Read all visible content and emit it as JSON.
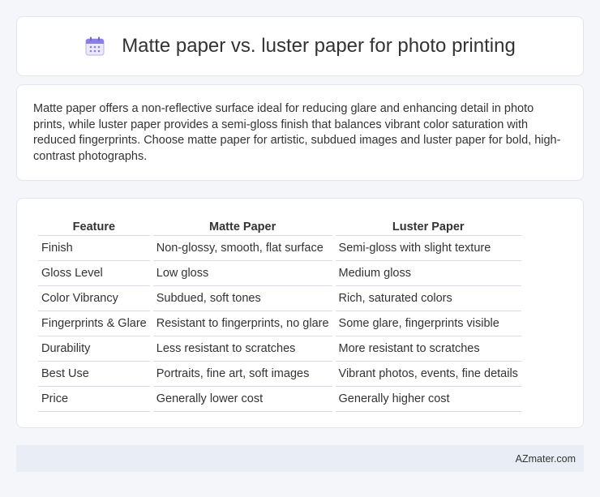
{
  "header": {
    "icon": "calendar-icon",
    "title": "Matte paper vs. luster paper for photo printing"
  },
  "intro": {
    "text": "Matte paper offers a non-reflective surface ideal for reducing glare and enhancing detail in photo prints, while luster paper provides a semi-gloss finish that balances vibrant color saturation with reduced fingerprints. Choose matte paper for artistic, subdued images and luster paper for bold, high-contrast photographs."
  },
  "table": {
    "headers": [
      "Feature",
      "Matte Paper",
      "Luster Paper"
    ],
    "rows": [
      [
        "Finish",
        "Non-glossy, smooth, flat surface",
        "Semi-gloss with slight texture"
      ],
      [
        "Gloss Level",
        "Low gloss",
        "Medium gloss"
      ],
      [
        "Color Vibrancy",
        "Subdued, soft tones",
        "Rich, saturated colors"
      ],
      [
        "Fingerprints & Glare",
        "Resistant to fingerprints, no glare",
        "Some glare, fingerprints visible"
      ],
      [
        "Durability",
        "Less resistant to scratches",
        "More resistant to scratches"
      ],
      [
        "Best Use",
        "Portraits, fine art, soft images",
        "Vibrant photos, events, fine details"
      ],
      [
        "Price",
        "Generally lower cost",
        "Generally higher cost"
      ]
    ]
  },
  "footer": {
    "brand": "AZmater.com"
  },
  "colors": {
    "background": "#f5f6fa",
    "card": "#ffffff",
    "footer": "#e9edf6",
    "icon_accent": "#8b7fe0"
  }
}
